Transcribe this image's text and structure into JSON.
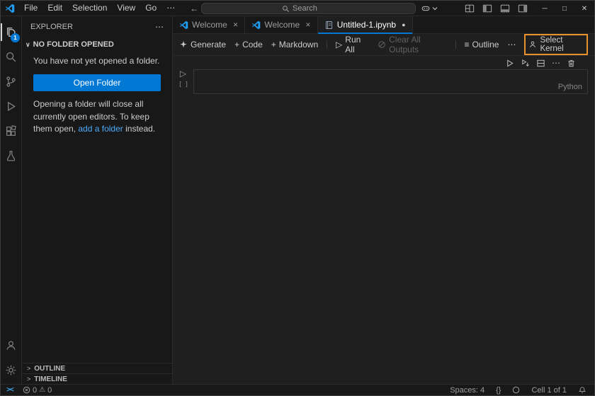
{
  "title_bar": {
    "menus": [
      "File",
      "Edit",
      "Selection",
      "View",
      "Go"
    ],
    "menus_more": "⋯",
    "back": "←",
    "forward": "→",
    "search_placeholder": "Search",
    "minimize": "─",
    "maximize": "□",
    "close": "✕"
  },
  "activity_bar": {
    "explorer_badge": "1"
  },
  "sidebar": {
    "title": "EXPLORER",
    "more": "⋯",
    "section_chevron": "∨",
    "section": "NO FOLDER OPENED",
    "empty_message": "You have not yet opened a folder.",
    "open_folder": "Open Folder",
    "note_1": "Opening a folder will close all currently open editors. To keep them open, ",
    "note_link": "add a folder",
    "note_2": " instead.",
    "outline": "OUTLINE",
    "timeline": "TIMELINE",
    "chevron_right": ">"
  },
  "tabs": [
    {
      "label": "Welcome",
      "close": "✕"
    },
    {
      "label": "Welcome",
      "close": "✕"
    },
    {
      "label": "Untitled-1.ipynb",
      "dot": "●"
    }
  ],
  "notebook_toolbar": {
    "generate": "Generate",
    "plus": "+",
    "code": "Code",
    "markdown": "Markdown",
    "run_icon": "▷",
    "run_all": "Run All",
    "clear_outputs": "Clear All Outputs",
    "outline_icon": "≡",
    "outline": "Outline",
    "more": "⋯",
    "select_kernel": "Select Kernel"
  },
  "cell": {
    "run": "▷",
    "exec_count": "[ ]",
    "toolbar_more": "⋯",
    "language": "Python"
  },
  "status_bar": {
    "remote": "><",
    "errors": "0",
    "warning_icon": "⚠",
    "warnings": "0",
    "spaces": "Spaces: 4",
    "braces": "{}",
    "cell_indicator": "Cell 1 of 1"
  }
}
